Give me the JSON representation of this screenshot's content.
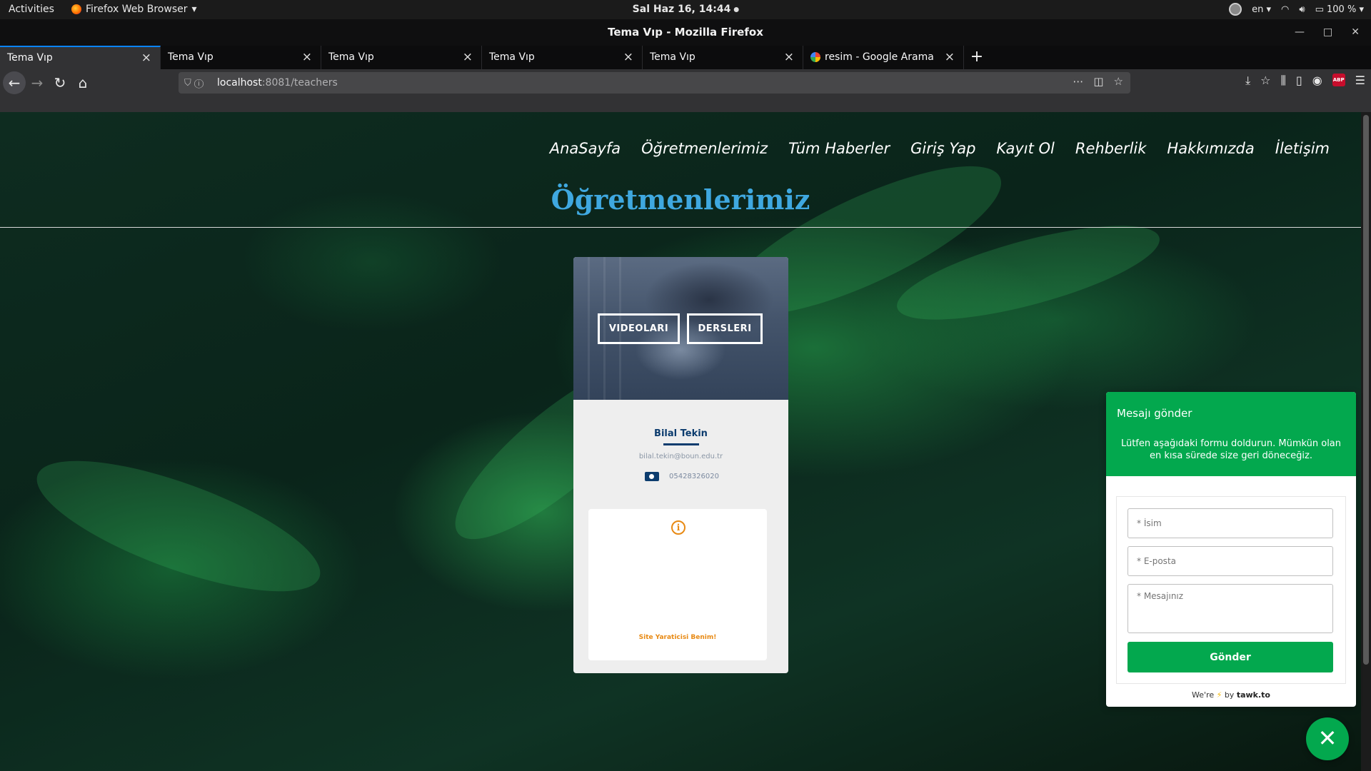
{
  "system": {
    "activities": "Activities",
    "app_menu": "Firefox Web Browser",
    "clock": "Sal Haz 16, 14:44",
    "lang": "en",
    "battery": "100 %"
  },
  "window": {
    "title": "Tema Vıp - Mozilla Firefox"
  },
  "tabs": [
    {
      "label": "Tema Vıp"
    },
    {
      "label": "Tema Vıp"
    },
    {
      "label": "Tema Vıp"
    },
    {
      "label": "Tema Vıp"
    },
    {
      "label": "Tema Vıp"
    },
    {
      "label": "resim - Google Arama"
    }
  ],
  "url": {
    "host": "localhost",
    "path": ":8081/teachers"
  },
  "site": {
    "nav": [
      "AnaSayfa",
      "Öğretmenlerimiz",
      "Tüm Haberler",
      "Giriş Yap",
      "Kayıt Ol",
      "Rehberlik",
      "Hakkımızda",
      "İletişim"
    ],
    "heading": "Öğretmenlerimiz"
  },
  "teacher": {
    "videos_label": "VIDEOLARI",
    "lessons_label": "DERSLERI",
    "name": "Bilal Tekin",
    "email": "bilal.tekin@boun.edu.tr",
    "phone": "05428326020",
    "info_text": "Site Yaraticisi Benim!"
  },
  "chat": {
    "title": "Mesajı gönder",
    "subtitle": "Lütfen aşağıdaki formu doldurun. Mümkün olan en kısa sürede size geri döneceğiz.",
    "name_placeholder": "* İsim",
    "email_placeholder": "* E-posta",
    "message_placeholder": "* Mesajınız",
    "send_label": "Gönder",
    "footer_pre": "We're",
    "footer_by": "by",
    "footer_brand": "tawk.to"
  },
  "colors": {
    "heading": "#3fa8e0",
    "tawk_green": "#03a84e",
    "info_orange": "#e88a14",
    "name_blue": "#0c3c6e"
  }
}
